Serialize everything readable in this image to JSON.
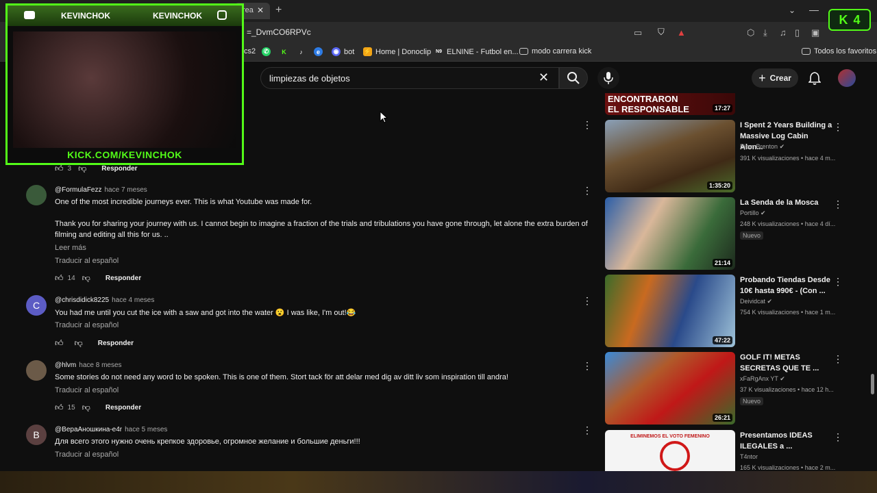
{
  "browser": {
    "tab_fragment": "Drea",
    "url": "=_DvmCO6RPVc",
    "bookmarks": [
      {
        "label": "cs2"
      },
      {
        "label": ""
      },
      {
        "label": ""
      },
      {
        "label": ""
      },
      {
        "label": ""
      },
      {
        "label": "bot"
      },
      {
        "label": "Home | Donoclip"
      },
      {
        "label": "ELNINE - Futbol en..."
      },
      {
        "label": "modo carrera kick"
      },
      {
        "label": "Todos los favoritos"
      }
    ],
    "kick_badge_count": "4"
  },
  "overlay": {
    "name_left": "KEVINCHOK",
    "name_right": "KEVINCHOK",
    "footer": "KICK.COM/KEVINCHOK"
  },
  "header": {
    "search_query": "limpiezas de objetos",
    "create_label": "Crear"
  },
  "comments": [
    {
      "author": "",
      "time": "",
      "text": "",
      "likes": "3",
      "reply": "Responder"
    },
    {
      "author": "@FormulaFezz",
      "time": "hace 7 meses",
      "text": "One of the most incredible journeys ever.  This is what Youtube was made for.",
      "text2": "Thank you for sharing your journey with us.  I cannot begin to imagine a fraction of the trials and tribulations you have gone through, let alone the extra burden of filming and editing all this for us. ..",
      "read_more": "Leer más",
      "translate": "Traducir al español",
      "likes": "14",
      "reply": "Responder"
    },
    {
      "author": "@chrisdidick8225",
      "time": "hace 4 meses",
      "avatar_letter": "C",
      "text": "You had me until you cut the ice with a saw and got into the water 😮  I was like, I'm out!😂",
      "translate": "Traducir al español",
      "likes": "",
      "reply": "Responder"
    },
    {
      "author": "@hlvm",
      "time": "hace 8 meses",
      "text": "Some stories do not need any word to be spoken. This is one of them. Stort tack för att delar med dig av ditt liv som inspiration till andra!",
      "translate": "Traducir al español",
      "likes": "15",
      "reply": "Responder"
    },
    {
      "author": "@ВераАношкина-е4r",
      "time": "hace 5 meses",
      "avatar_letter": "B",
      "text": "Для всего этого нужно очень крепкое здоровье, огромное желание и  большие деньги!!!",
      "translate": "Traducir al español",
      "likes": "",
      "reply": "Responder"
    }
  ],
  "sidebar": {
    "top_thumb_text1": "ENCONTRARON",
    "top_thumb_text2": "EL RESPONSABLE",
    "top_thumb_duration": "17:27",
    "videos": [
      {
        "title": "I Spent 2 Years Building a Massive Log Cabin Alon...",
        "channel": "Bjorn Brenton",
        "meta": "391 K visualizaciones • hace 4 m...",
        "duration": "1:35:20",
        "badge": ""
      },
      {
        "title": "La Senda de la Mosca",
        "channel": "Portillo",
        "meta": "248 K visualizaciones • hace 4 dí...",
        "duration": "21:14",
        "badge": "Nuevo"
      },
      {
        "title": "Probando Tiendas Desde 10€ hasta 990€ - (Con ...",
        "channel": "Deividcat",
        "meta": "754 K visualizaciones • hace 1 m...",
        "duration": "47:22",
        "badge": ""
      },
      {
        "title": "GOLF IT! METAS SECRETAS QUE TE ...",
        "channel": "xFaRgAnx YT",
        "meta": "37 K visualizaciones • hace 12 h...",
        "duration": "26:21",
        "badge": "Nuevo"
      },
      {
        "title": "Presentamos IDEAS ILEGALES a ...",
        "channel": "T4ntor",
        "meta": "165 K visualizaciones • hace 2 m...",
        "duration": "",
        "badge": "",
        "thumb_caption": "ELIMINEMOS EL VOTO FEMENINO"
      }
    ]
  },
  "colors": {
    "kick_green": "#53fc18",
    "bg": "#0f0f0f"
  }
}
